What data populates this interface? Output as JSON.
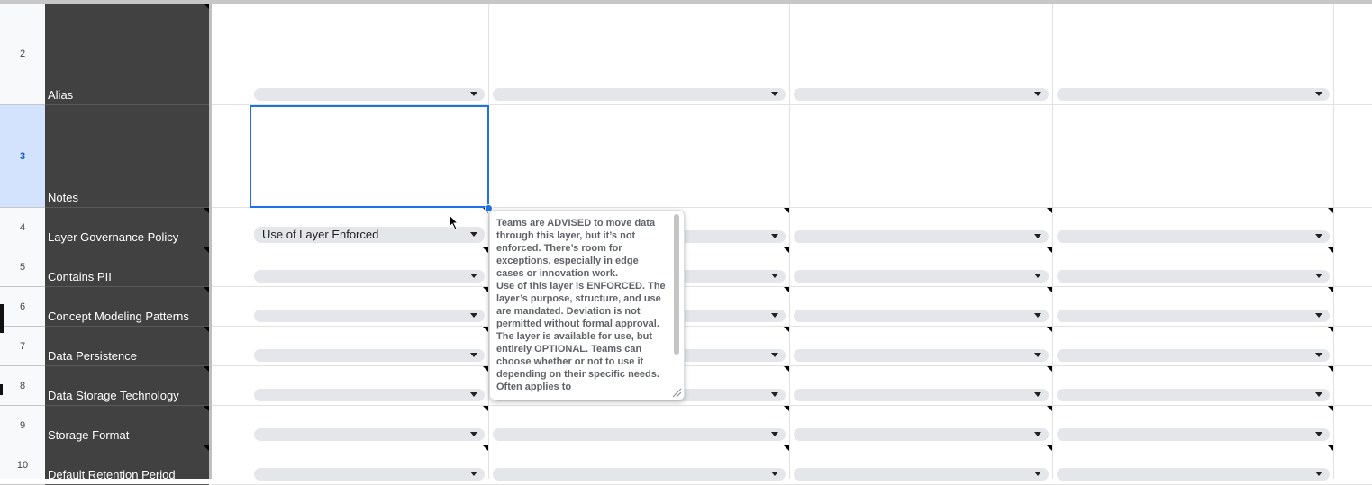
{
  "rows": [
    {
      "num": "2",
      "label": "Alias",
      "selected": false
    },
    {
      "num": "3",
      "label": "Notes",
      "selected": true
    },
    {
      "num": "4",
      "label": "Layer Governance Policy",
      "selected": false
    },
    {
      "num": "5",
      "label": "Contains PII",
      "selected": false
    },
    {
      "num": "6",
      "label": "Concept Modeling Patterns",
      "selected": false
    },
    {
      "num": "7",
      "label": "Data Persistence",
      "selected": false
    },
    {
      "num": "8",
      "label": "Data Storage Technology",
      "selected": false
    },
    {
      "num": "9",
      "label": "Storage Format",
      "selected": false
    },
    {
      "num": "10",
      "label": "Default Retention Period",
      "selected": false
    }
  ],
  "governance_value": "Use of Layer Enforced",
  "popup": {
    "paragraphs": [
      "Teams are ADVISED to move data through this layer, but it’s not enforced. There’s room for exceptions, especially in edge cases or innovation work.",
      "Use of this layer is ENFORCED. The layer’s purpose, structure, and use are mandated. Deviation is not permitted without formal approval.",
      "The layer is available for use, but entirely OPTIONAL. Teams can choose whether or not to use it depending on their specific needs. Often applies to"
    ]
  },
  "colors": {
    "header_bg": "#414141",
    "selection": "#1a73e8",
    "chip": "#e4e6e9",
    "selected_rownum_bg": "#d3e3fd"
  },
  "icons": [
    "dropdown-caret-icon",
    "comment-triangle-icon",
    "mouse-pointer-icon",
    "resize-handle-icon"
  ]
}
